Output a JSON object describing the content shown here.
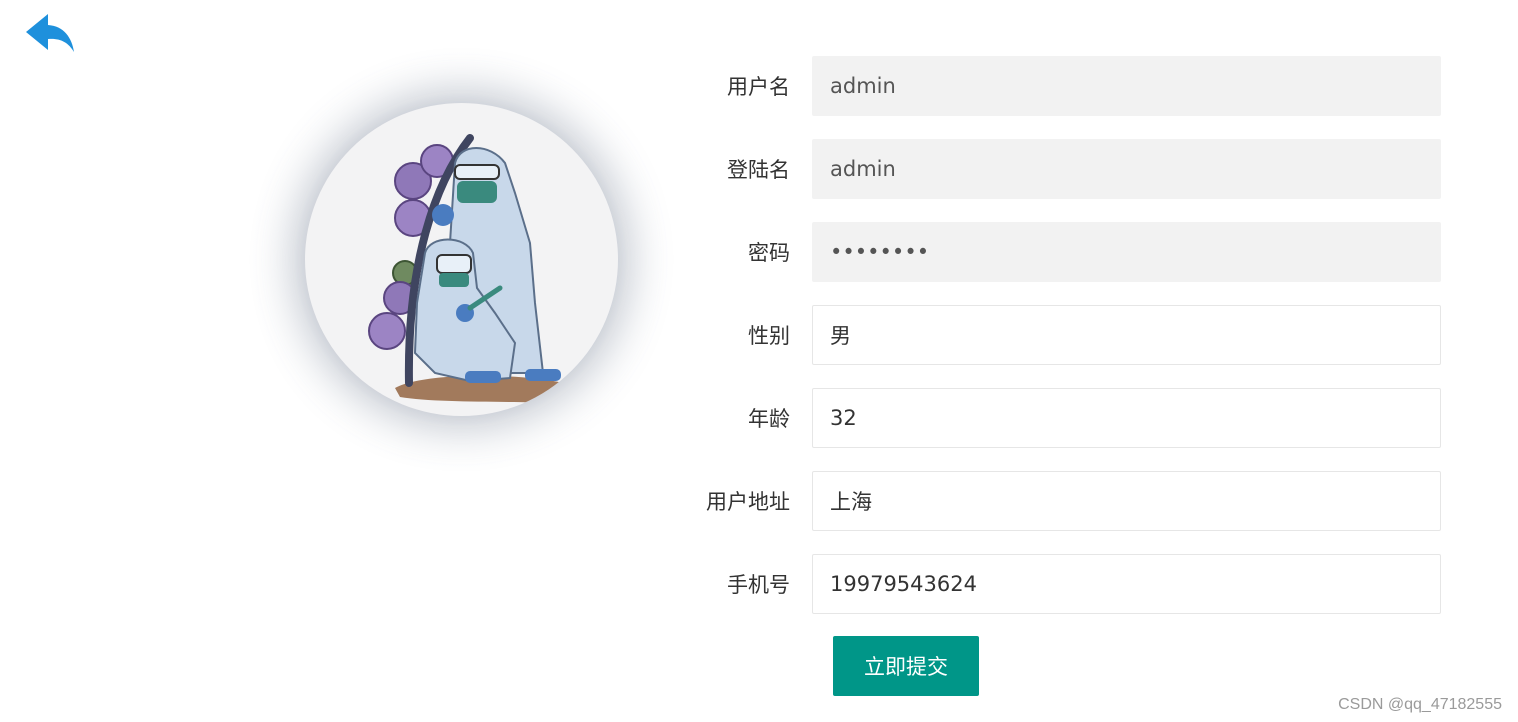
{
  "form": {
    "fields": [
      {
        "label": "用户名",
        "value": "admin",
        "disabled": true,
        "type": "text"
      },
      {
        "label": "登陆名",
        "value": "admin",
        "disabled": true,
        "type": "text"
      },
      {
        "label": "密码",
        "value": "••••••••",
        "disabled": true,
        "type": "password"
      },
      {
        "label": "性别",
        "value": "男",
        "disabled": false,
        "type": "text"
      },
      {
        "label": "年龄",
        "value": "32",
        "disabled": false,
        "type": "text"
      },
      {
        "label": "用户地址",
        "value": "上海",
        "disabled": false,
        "type": "text"
      },
      {
        "label": "手机号",
        "value": "19979543624",
        "disabled": false,
        "type": "text"
      }
    ],
    "submit_label": "立即提交"
  },
  "watermark": "CSDN @qq_47182555",
  "icons": {
    "back": "back-arrow-icon"
  },
  "colors": {
    "accent": "#009688",
    "back_icon": "#1e90dc",
    "disabled_bg": "#f2f2f2"
  }
}
